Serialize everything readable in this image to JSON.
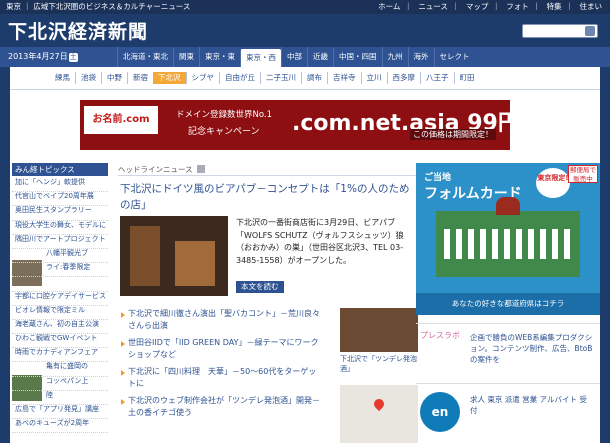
{
  "topbar": {
    "left": "東京 ｜ 広域下北沢圏のビジネス＆カルチャーニュース",
    "links": [
      "ホーム",
      "ニュース",
      "マップ",
      "フォト",
      "特集",
      "住まい"
    ]
  },
  "site": {
    "title": "下北沢経済新聞"
  },
  "date": {
    "text": "2013年4月27日",
    "dow": "土"
  },
  "regions": [
    "北海道・東北",
    "関東",
    "東京・東",
    "東京・西",
    "中部",
    "近畿",
    "中国・四国",
    "九州",
    "海外",
    "セレクト"
  ],
  "areas": [
    "練馬",
    "池袋",
    "中野",
    "新宿",
    "下北沢",
    "シブヤ",
    "自由が丘",
    "二子玉川",
    "調布",
    "吉祥寺",
    "立川",
    "西多摩",
    "八王子",
    "町田"
  ],
  "banner": {
    "brand": "お名前.com",
    "line1": "ドメイン登録数世界No.1",
    "line2": "記念キャンペーン",
    "big": ".com.net.asia 99円",
    "note": "この価格は期間限定！"
  },
  "left": {
    "header": "みん経トピックス",
    "items": [
      "加に「ヘンジ」軟提供",
      "代官山でベイプ20周年展",
      "奥田民生スタンプラリー",
      "現役大学生の舞女、モデルに",
      "隅田川でアートプロジェクト",
      "八幡平観光ブ",
      "ライ:春季限定",
      "",
      "宇都に口腔ケアデイサービス",
      "ビオレ情報で限定ミル",
      "海老蔵さん、初の自主公演",
      "ひわこ観戦でGWイベント",
      "時雨でカナディアンフェア",
      "亀有に盛岡の",
      "コッペパン上",
      "陸",
      "広島で「アプリ発見」講座",
      "あべのキューズが2周年"
    ]
  },
  "headline": {
    "section": "ヘッドラインニュース",
    "title": "下北沢にドイツ風のビアパブ－コンセプトは「1%の人のための店」",
    "lead": "下北沢の一番街商店街に3月29日、ビアパブ「WOLFS SCHUTZ（ヴォルフスシュッツ）狼（おおかみ）の巣」（世田谷区北沢3、TEL 03-3485-1558）がオープンした。",
    "readmore": "本文を読む"
  },
  "news": [
    "下北沢で細川徹さん演出「聖バカコント」－荒川良々さんら出演",
    "世田谷IIDで「IID GREEN DAY」－緑テーマにワークショップなど",
    "下北沢に「四川料理　天華」－50～60代をターゲットに",
    "下北沢のウェブ制作会社が「ツンデレ発泡酒」開発－土の香イチゴ使う"
  ],
  "side": {
    "caption": "下北沢で「ツンデレ発泡酒」"
  },
  "ads": {
    "form_top": "ご当地",
    "form_title": "フォルムカード",
    "badge": "東京限定!",
    "badge2": "郵便局で販売中",
    "form_foot": "あなたの好きな都道府県はコチラ",
    "ad1_logo": "プレスラボ",
    "ad1_text": "企画で勝負のWEB系編集プロダクション。コンテンツ制作、広告、BtoBの案件を",
    "ad2_logo": "en",
    "ad2_text": "求人 東京 派遣 営業 アルバイト 受付"
  }
}
